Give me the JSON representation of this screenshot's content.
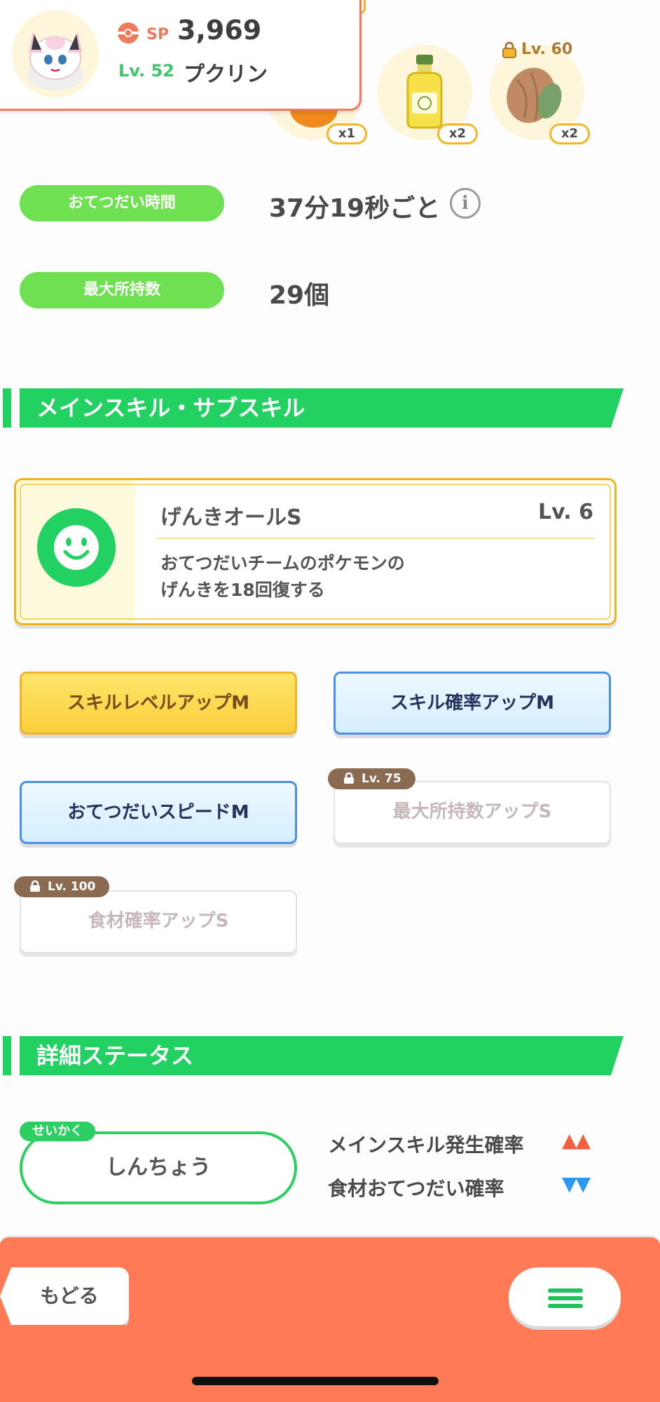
{
  "header": {
    "sp_label": "SP",
    "sp_value": "3,969",
    "level": "Lv. 52",
    "pokemon_name": "プクリン"
  },
  "ingredients": [
    {
      "name": "honey",
      "count": "x1"
    },
    {
      "name": "oil",
      "count": "x2"
    },
    {
      "name": "cacao",
      "count": "x2",
      "unlock_level": "Lv. 60"
    }
  ],
  "help_time": {
    "label": "おてつだい時間",
    "value": "37分19秒ごと"
  },
  "max_carry": {
    "label": "最大所持数",
    "value": "29個"
  },
  "skills_section": {
    "title": "メインスキル・サブスキル"
  },
  "main_skill": {
    "name": "げんきオールS",
    "level": "Lv. 6",
    "desc_line1": "おてつだいチームのポケモンの",
    "desc_line2": "げんきを18回復する"
  },
  "sub_skills": [
    {
      "label": "スキルレベルアップM",
      "style": "gold"
    },
    {
      "label": "スキル確率アップM",
      "style": "blue"
    },
    {
      "label": "おてつだいスピードM",
      "style": "blue"
    },
    {
      "label": "最大所持数アップS",
      "style": "locked",
      "unlock_level": "Lv. 75"
    },
    {
      "label": "食材確率アップS",
      "style": "locked",
      "unlock_level": "Lv. 100"
    }
  ],
  "status_section": {
    "title": "詳細ステータス"
  },
  "nature": {
    "tag": "せいかく",
    "name": "しんちょう",
    "up_label": "メインスキル発生確率",
    "up_arrows": "▲▲",
    "down_label": "食材おてつだい確率",
    "down_arrows": "▼▼"
  },
  "footer": {
    "back_label": "もどる"
  },
  "colors": {
    "accent_green": "#23d163",
    "footer_orange": "#ff7a55",
    "gold": "#f2b21c",
    "up_red": "#f0603c",
    "down_blue": "#2d9af0"
  }
}
